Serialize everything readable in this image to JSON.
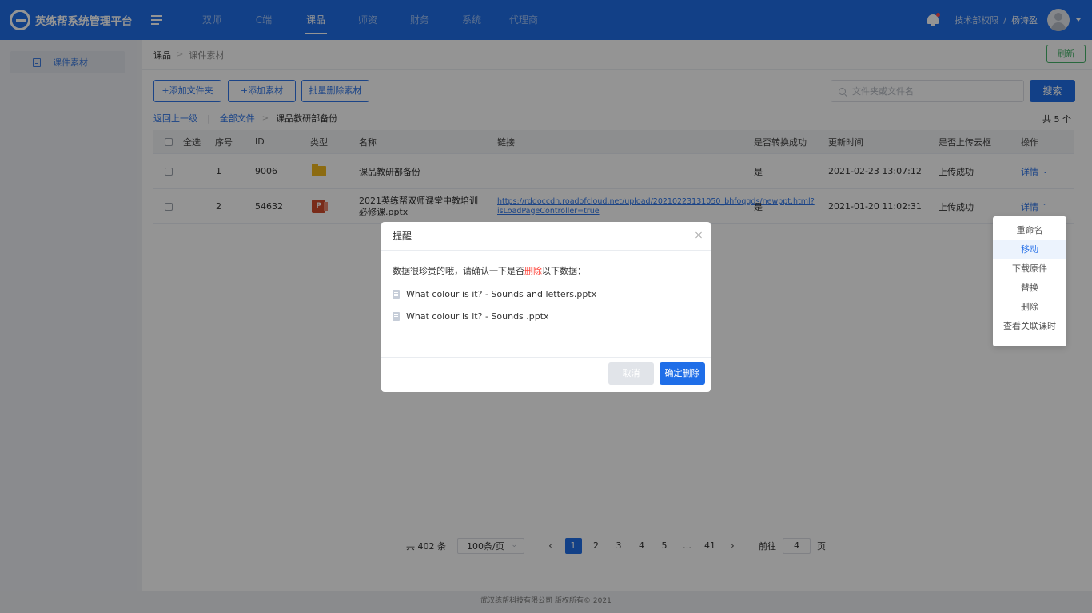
{
  "header": {
    "logo_text": "英练帮系统管理平台",
    "nav": [
      "双师",
      "C端",
      "课品",
      "师资",
      "财务",
      "系统",
      "代理商"
    ],
    "active_nav": "课品",
    "dept": "技术部权限",
    "separator": "/",
    "user": "杨诗盈"
  },
  "sidebar": {
    "items": [
      {
        "label": "课件素材"
      }
    ]
  },
  "breadcrumb": {
    "home": "课品",
    "arrow": ">",
    "current": "课件素材"
  },
  "refresh_label": "刷新",
  "toolbar": {
    "add_folder": "+添加文件夹",
    "add_material": "+添加素材",
    "batch_delete": "批量删除素材",
    "search_placeholder": "文件夹或文件名",
    "search_button": "搜索"
  },
  "path": {
    "back": "返回上一级",
    "all_files": "全部文件",
    "current": "课品教研部备份",
    "total": "共 5 个"
  },
  "table": {
    "headers": {
      "select_all": "全选",
      "index": "序号",
      "id": "ID",
      "type": "类型",
      "name": "名称",
      "link": "链接",
      "converted": "是否转换成功",
      "updated": "更新时间",
      "uploaded": "是否上传云枢",
      "action": "操作"
    },
    "rows": [
      {
        "index": "1",
        "id": "9006",
        "type_icon": "folder-icon",
        "name": "课品教研部备份",
        "link": "",
        "converted": "是",
        "updated": "2021-02-23  13:07:12",
        "uploaded": "上传成功",
        "action": "详情"
      },
      {
        "index": "2",
        "id": "54632",
        "type_icon": "ppt-icon",
        "type_glyph": "P",
        "name": "2021英练帮双师课堂中教培训必修课.pptx",
        "link": "https://rddoccdn.roadofcloud.net/upload/20210223131050_bhfoqgds/newppt.html?isLoadPageController=true",
        "converted": "是",
        "updated": "2021-01-20  11:02:31",
        "uploaded": "上传成功",
        "action": "详情"
      }
    ]
  },
  "dropdown": {
    "items": [
      "重命名",
      "移动",
      "下载原件",
      "替换",
      "删除",
      "查看关联课时"
    ],
    "highlighted": "移动"
  },
  "pagination": {
    "total": "共 402 条",
    "page_size": "100条/页",
    "prev": "‹",
    "pages": [
      "1",
      "2",
      "3",
      "4",
      "5",
      "…",
      "41"
    ],
    "active_page": "1",
    "next": "›",
    "goto_prefix": "前往",
    "goto_value": "4",
    "goto_suffix": "页"
  },
  "modal": {
    "title": "提醒",
    "message_before": "数据很珍贵的哦，请确认一下是否",
    "message_danger": "删除",
    "message_after": "以下数据：",
    "files": [
      "What colour is it? - Sounds and letters.pptx",
      "What colour is it? - Sounds .pptx"
    ],
    "cancel": "取消",
    "confirm": "确定删除"
  },
  "footer": "武汉练帮科技有限公司 版权所有© 2021",
  "colors": {
    "primary": "#1f6ee8",
    "danger": "#ff3b30",
    "refresh": "#46b36a"
  }
}
